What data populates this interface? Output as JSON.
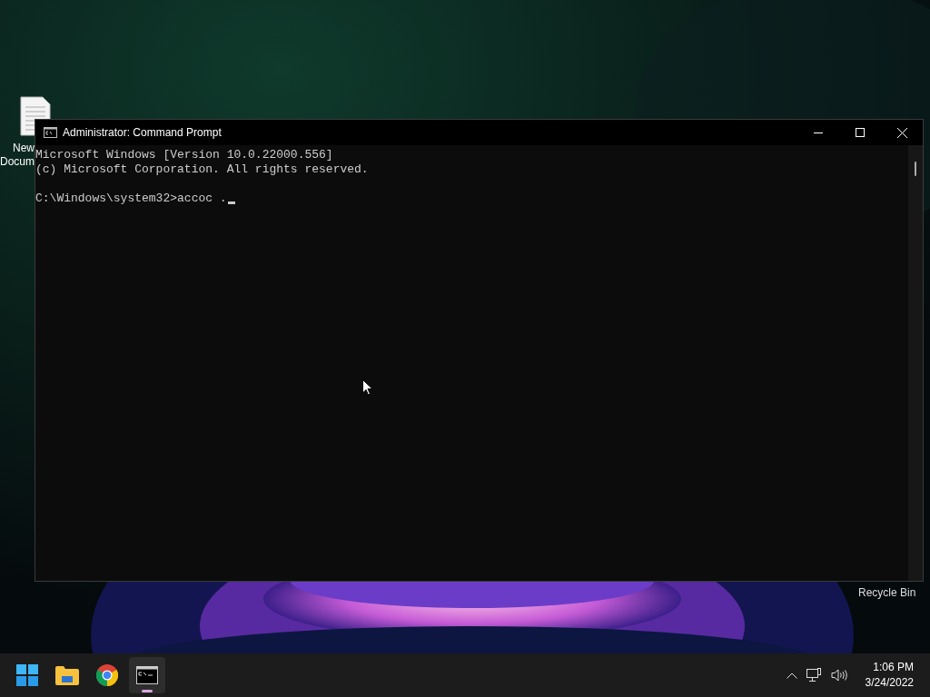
{
  "desktop": {
    "icons": [
      {
        "label_lines": [
          "New",
          "Docum"
        ]
      },
      {
        "label_lines": [
          "Recycle Bin"
        ]
      }
    ]
  },
  "window": {
    "title": "Administrator: Command Prompt",
    "console_blocks": [
      [
        "Microsoft Windows [Version 10.0.22000.556]",
        "(c) Microsoft Corporation. All rights reserved."
      ],
      [
        "C:\\Windows\\system32>accoc ."
      ]
    ]
  },
  "taskbar": {
    "apps": [
      {
        "kind": "start",
        "selected": false
      },
      {
        "kind": "folder",
        "selected": false
      },
      {
        "kind": "chrome",
        "selected": false
      },
      {
        "kind": "terminal",
        "selected": true
      }
    ],
    "clock": {
      "time": "1:06 PM",
      "date": "3/24/2022"
    }
  }
}
